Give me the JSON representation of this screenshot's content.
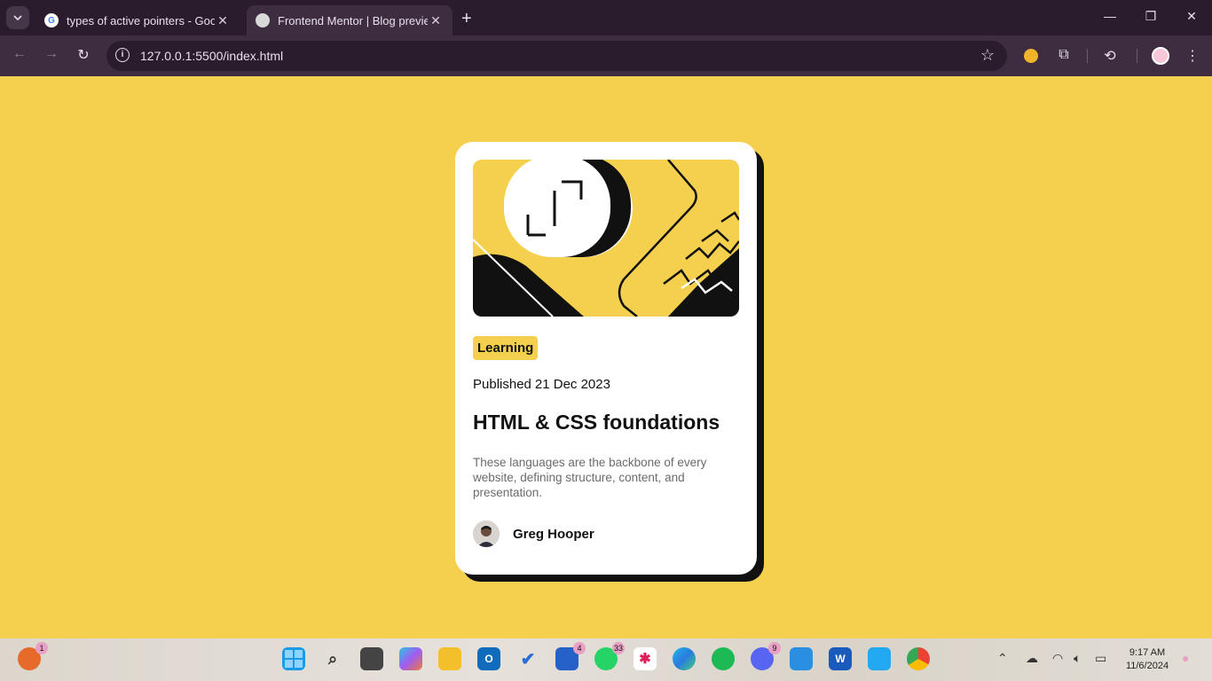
{
  "browser": {
    "tabs": [
      {
        "title": "types of active pointers - Googl",
        "favicon": "google-icon"
      },
      {
        "title": "Frontend Mentor | Blog preview",
        "favicon": "frontend-mentor-icon"
      }
    ],
    "url": "127.0.0.1:5500/index.html"
  },
  "card": {
    "tag": "Learning",
    "published_label": "Published",
    "published_date": "21 Dec 2023",
    "title": "HTML & CSS foundations",
    "description": "These languages are the backbone of every website, defining structure, content, and presentation.",
    "author": "Greg Hooper"
  },
  "taskbar": {
    "badges": {
      "firefox": "1",
      "teams": "4",
      "whatsapp": "33",
      "discord": "9"
    },
    "time": "9:17 AM",
    "date": "11/6/2024"
  },
  "colors": {
    "page_background": "#f4d04e",
    "card_background": "#ffffff",
    "tab_bar": "#2b1c2d",
    "toolbar": "#3e2d41",
    "text_primary": "#111111",
    "text_secondary": "#6b6b6b"
  }
}
